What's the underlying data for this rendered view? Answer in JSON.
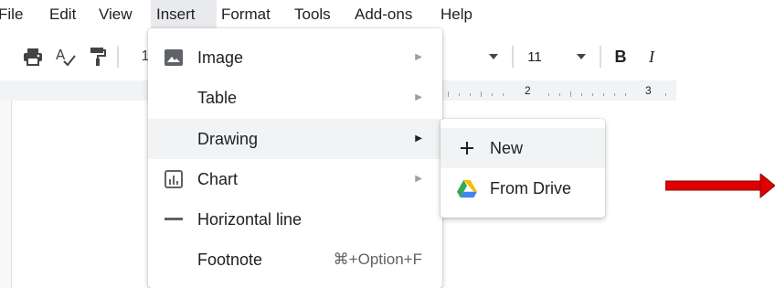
{
  "menubar": {
    "items": [
      {
        "label": "File"
      },
      {
        "label": "Edit"
      },
      {
        "label": "View"
      },
      {
        "label": "Insert"
      },
      {
        "label": "Format"
      },
      {
        "label": "Tools"
      },
      {
        "label": "Add-ons"
      },
      {
        "label": "Help"
      }
    ],
    "active": "Insert"
  },
  "toolbar": {
    "font_size": "11",
    "bold_label": "B",
    "italic_label": "I",
    "partial_label": "1",
    "icons": [
      "print-icon",
      "spellcheck-icon",
      "paint-format-icon",
      "chevron-down-icon"
    ]
  },
  "ruler": {
    "marks": [
      "2",
      "3"
    ]
  },
  "insert_menu": {
    "items": [
      {
        "label": "Image",
        "icon": "image-icon",
        "has_submenu": true
      },
      {
        "label": "Table",
        "icon": "",
        "has_submenu": true
      },
      {
        "label": "Drawing",
        "icon": "",
        "has_submenu": true,
        "highlighted": true
      },
      {
        "label": "Chart",
        "icon": "chart-icon",
        "has_submenu": true
      },
      {
        "label": "Horizontal line",
        "icon": "horizontal-line-icon",
        "has_submenu": false
      },
      {
        "label": "Footnote",
        "icon": "",
        "has_submenu": false,
        "shortcut": "⌘+Option+F"
      }
    ]
  },
  "drawing_submenu": {
    "items": [
      {
        "label": "New",
        "icon": "plus-icon"
      },
      {
        "label": "From Drive",
        "icon": "google-drive-icon"
      }
    ]
  },
  "annotation": {
    "arrow_color": "#e00000"
  }
}
